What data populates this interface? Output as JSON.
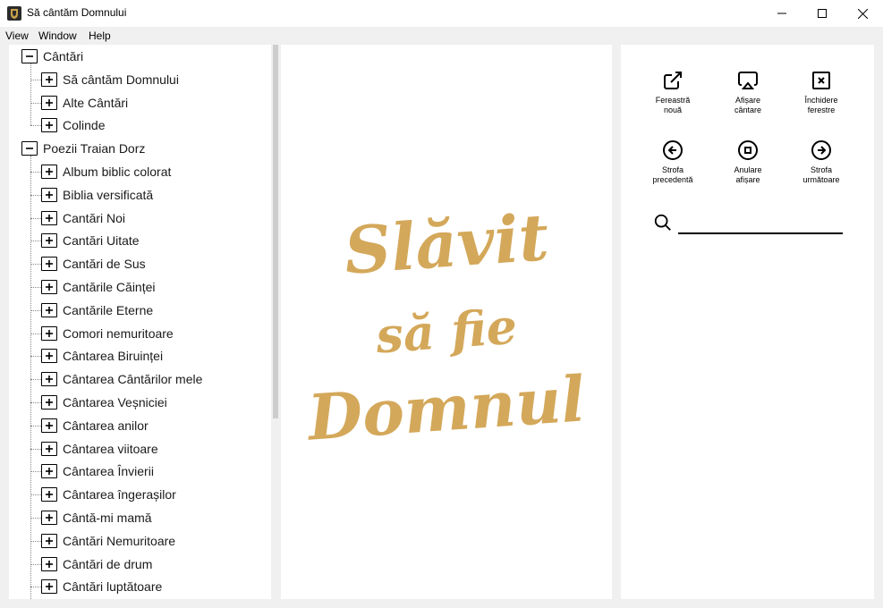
{
  "window": {
    "title": "Să cântăm Domnului",
    "icon": "app-logo-icon"
  },
  "menu": [
    "View",
    "Window",
    "Help"
  ],
  "tree": {
    "roots": [
      {
        "label": "Cântări",
        "expanded": true,
        "children": [
          "Să cântăm Domnului",
          "Alte Cântări",
          "Colinde"
        ]
      },
      {
        "label": "Poezii Traian Dorz",
        "expanded": true,
        "children": [
          "Album biblic colorat",
          "Biblia versificată",
          "Cantări Noi",
          "Cantări Uitate",
          "Cantări de Sus",
          "Cantările Căinței",
          "Cantările Eterne",
          "Comori nemuritoare",
          "Cântarea Biruinței",
          "Cântarea Cântărilor mele",
          "Cântarea Veșniciei",
          "Cântarea anilor",
          "Cântarea viitoare",
          "Cântarea Învierii",
          "Cântarea îngerașilor",
          "Cântă-mi mamă",
          "Cântări Nemuritoare",
          "Cântări de drum",
          "Cântări luptătoare"
        ]
      }
    ]
  },
  "preview": {
    "lines": [
      "Slăvit",
      "să fie",
      "Domnul"
    ],
    "color": "#d4a85a"
  },
  "controls": [
    {
      "icon": "external-window-icon",
      "label_lines": [
        "Fereastră",
        "nouă"
      ]
    },
    {
      "icon": "airplay-display-icon",
      "label_lines": [
        "Afișare",
        "cântare"
      ]
    },
    {
      "icon": "close-box-icon",
      "label_lines": [
        "Închidere",
        "ferestre"
      ]
    },
    {
      "icon": "arrow-left-circle-icon",
      "label_lines": [
        "Strofa",
        "precedentă"
      ]
    },
    {
      "icon": "stop-circle-icon",
      "label_lines": [
        "Anulare",
        "afișare"
      ]
    },
    {
      "icon": "arrow-right-circle-icon",
      "label_lines": [
        "Strofa",
        "următoare"
      ]
    }
  ],
  "search": {
    "value": "",
    "placeholder": ""
  }
}
